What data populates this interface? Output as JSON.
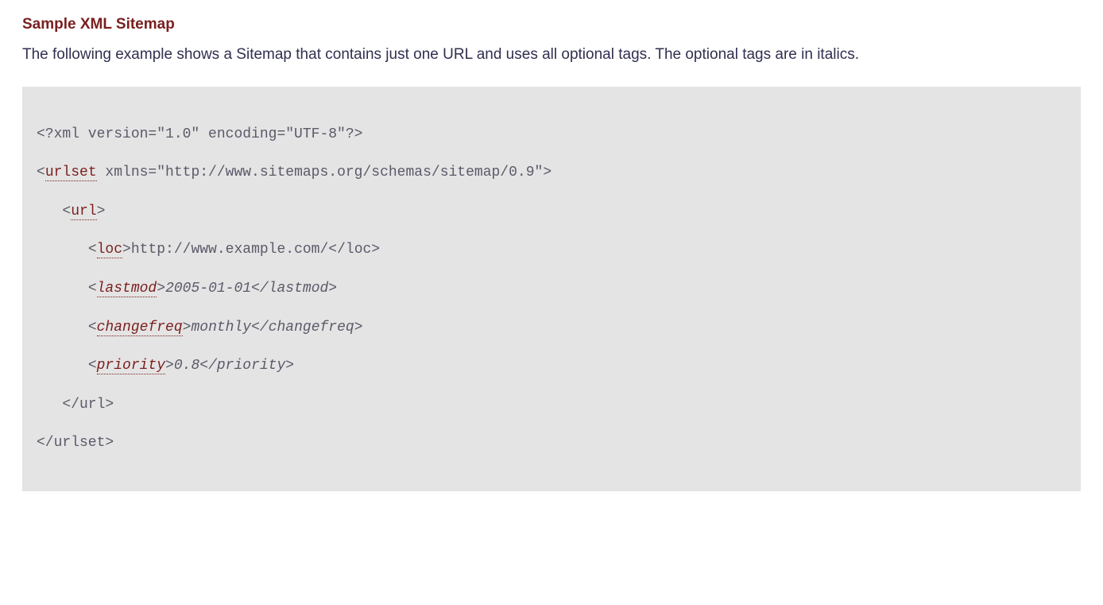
{
  "heading": "Sample XML Sitemap",
  "intro": "The following example shows a Sitemap that contains just one URL and uses all optional tags. The optional tags are in italics.",
  "code": {
    "xml_decl": "<?xml version=\"1.0\" encoding=\"UTF-8\"?>",
    "lt": "<",
    "gt": ">",
    "urlset_tag": "urlset",
    "urlset_attrs": " xmlns=\"http://www.sitemaps.org/schemas/sitemap/0.9\"",
    "url_tag": "url",
    "loc_tag": "loc",
    "loc_value": "http://www.example.com/",
    "loc_close": "</loc>",
    "lastmod_tag": "lastmod",
    "lastmod_value": "2005-01-01",
    "lastmod_close": "</lastmod>",
    "changefreq_tag": "changefreq",
    "changefreq_value": "monthly",
    "changefreq_close": "</changefreq>",
    "priority_tag": "priority",
    "priority_value": "0.8",
    "priority_close": "</priority>",
    "url_close": "</url>",
    "urlset_close": "</urlset>"
  }
}
